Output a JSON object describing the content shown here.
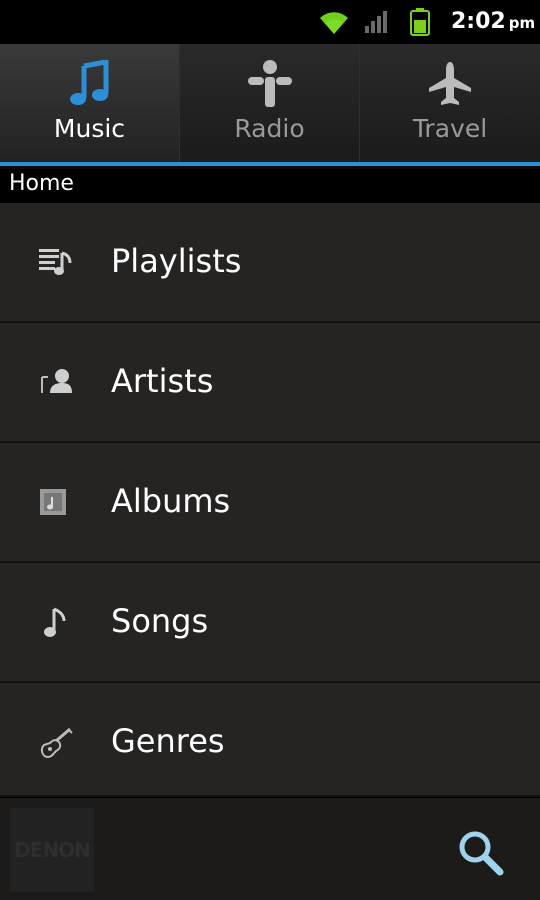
{
  "status": {
    "time": "2:02",
    "ampm": "pm",
    "icons": [
      "wifi-icon",
      "signal-icon",
      "battery-icon"
    ]
  },
  "tabs": [
    {
      "label": "Music",
      "icon": "music-note-icon",
      "active": true
    },
    {
      "label": "Radio",
      "icon": "tunein-radio-icon",
      "active": false
    },
    {
      "label": "Travel",
      "icon": "airplane-icon",
      "active": false
    }
  ],
  "breadcrumb": "Home",
  "list": [
    {
      "label": "Playlists",
      "icon": "playlist-icon"
    },
    {
      "label": "Artists",
      "icon": "artist-icon"
    },
    {
      "label": "Albums",
      "icon": "album-icon"
    },
    {
      "label": "Songs",
      "icon": "song-note-icon"
    },
    {
      "label": "Genres",
      "icon": "guitar-icon"
    }
  ],
  "footer": {
    "logo_text": "DENON",
    "search_icon": "search-icon"
  },
  "colors": {
    "accent": "#2d8fd6",
    "wifi": "#6fd21a",
    "battery": "#7ecf1c",
    "list_bg": "#262422"
  }
}
